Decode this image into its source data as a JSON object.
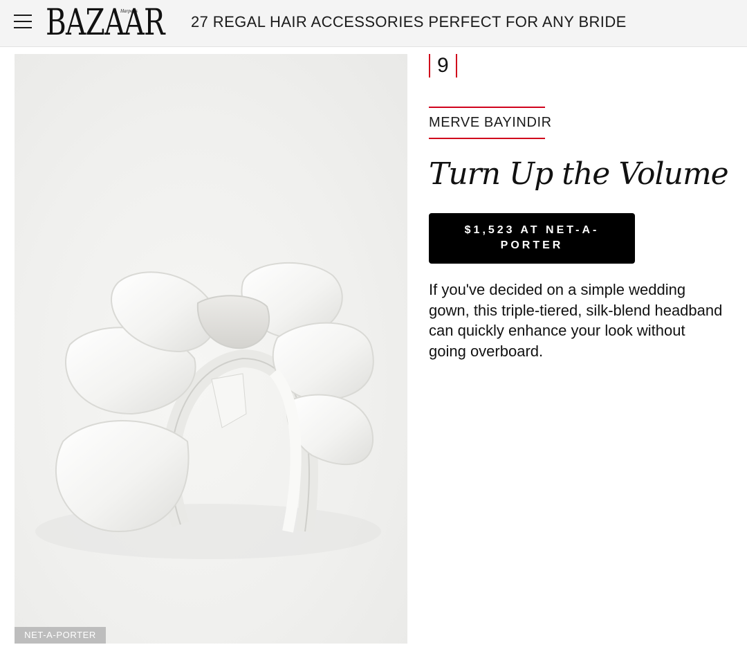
{
  "header": {
    "menu_icon": "hamburger-menu-icon",
    "logo": "BAZAAR",
    "logo_small": "Harper's",
    "title": "27 REGAL HAIR ACCESSORIES PERFECT FOR ANY BRIDE"
  },
  "product": {
    "number": "9",
    "brand": "MERVE BAYINDIR",
    "title": "Turn Up the Volume",
    "buy_label": "$1,523 AT NET-A-PORTER",
    "description": "If you've decided on a simple wedding gown, this triple-tiered, silk-blend headband can quickly enhance your look without going overboard.",
    "image_credit": "NET-A-PORTER"
  },
  "colors": {
    "accent": "#d0021b",
    "button_bg": "#000000",
    "header_bg": "#f4f4f4"
  }
}
